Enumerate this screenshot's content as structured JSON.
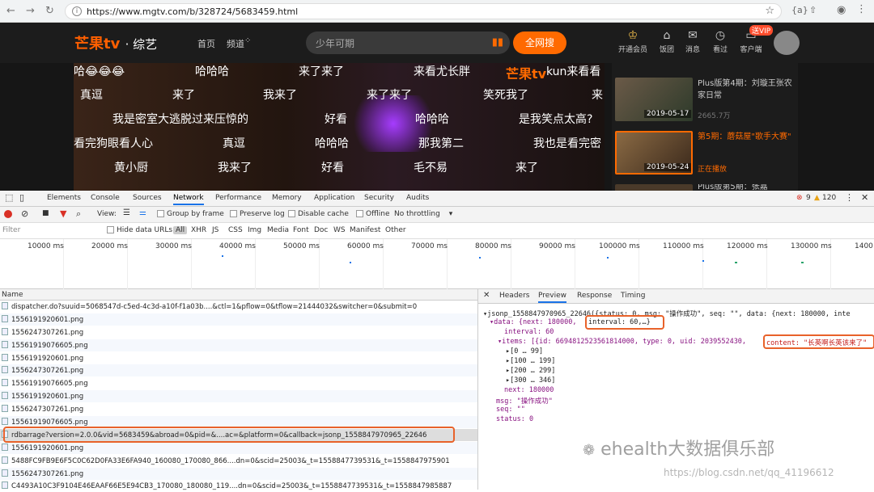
{
  "browser": {
    "url": "https://www.mgtv.com/b/328724/5683459.html",
    "ext1": "{a}",
    "ext2": "⇧"
  },
  "site": {
    "logo": "芒果tv",
    "logo_sub": "· 综艺",
    "nav": [
      "首页",
      "频道"
    ],
    "search_placeholder": "少年可期",
    "search_button": "全网搜",
    "icons": [
      {
        "name": "开通会员",
        "glyph": "♔"
      },
      {
        "name": "饭团",
        "glyph": "⌂"
      },
      {
        "name": "消息",
        "glyph": "✉"
      },
      {
        "name": "看过",
        "glyph": "◷"
      },
      {
        "name": "客户端",
        "glyph": "▭"
      }
    ],
    "vip_badge": "送VIP"
  },
  "danmaku": [
    {
      "text": "哈😂😂😂"
    },
    {
      "text": "哈哈哈"
    },
    {
      "text": "来了来了"
    },
    {
      "text": "来看尤长胖"
    },
    {
      "text": "kun来看看"
    },
    {
      "text": "真逗"
    },
    {
      "text": "来了"
    },
    {
      "text": "我来了"
    },
    {
      "text": "来了来了"
    },
    {
      "text": "笑死我了"
    },
    {
      "text": "来"
    },
    {
      "text": "我是密室大逃脱过来压惊的"
    },
    {
      "text": "好看"
    },
    {
      "text": "哈哈哈"
    },
    {
      "text": "是我笑点太高?"
    },
    {
      "text": "看完狗眼看人心"
    },
    {
      "text": "真逗"
    },
    {
      "text": "哈哈哈"
    },
    {
      "text": "那我第二"
    },
    {
      "text": "我也是看完密"
    },
    {
      "text": "黄小厨"
    },
    {
      "text": "我来了"
    },
    {
      "text": "好看"
    },
    {
      "text": "毛不易"
    },
    {
      "text": "来了"
    }
  ],
  "video_watermark": "芒果tv",
  "playlist": [
    {
      "title": "Plus版第4期：刘璇王张农家日常",
      "date": "2019-05-17",
      "meta": "2665.7万"
    },
    {
      "title": "第5期：蘑菇屋\"歌手大赛\"",
      "date": "2019-05-24",
      "meta": "正在播放"
    },
    {
      "title": "Plus版第5期：张嘉"
    }
  ],
  "devtools": {
    "tabs": [
      "Elements",
      "Console",
      "Sources",
      "Network",
      "Performance",
      "Memory",
      "Application",
      "Security",
      "Audits"
    ],
    "active_tab": "Network",
    "errors": "9",
    "warnings": "120",
    "toolbar": {
      "view": "View:",
      "group": "Group by frame",
      "preserve": "Preserve log",
      "cache": "Disable cache",
      "offline": "Offline",
      "throttle": "No throttling"
    },
    "filter": {
      "placeholder": "Filter",
      "hide": "Hide data URLs",
      "types": [
        "All",
        "XHR",
        "JS",
        "CSS",
        "Img",
        "Media",
        "Font",
        "Doc",
        "WS",
        "Manifest",
        "Other"
      ]
    },
    "ticks": [
      "10000 ms",
      "20000 ms",
      "30000 ms",
      "40000 ms",
      "50000 ms",
      "60000 ms",
      "70000 ms",
      "80000 ms",
      "90000 ms",
      "100000 ms",
      "110000 ms",
      "120000 ms",
      "130000 ms",
      "1400"
    ],
    "list_header": "Name",
    "requests": [
      "dispatcher.do?suuid=5068547d-c5ed-4c3d-a10f-f1a03b....&ctl=1&pflow=0&tflow=21444032&switcher=0&submit=0",
      "1556191920601.png",
      "1556247307261.png",
      "1556191907660​5.png",
      "1556191920601.png",
      "1556247307261.png",
      "1556191907660​5.png",
      "1556191920601.png",
      "1556247307261.png",
      "1556191907660​5.png",
      "rdbarrage?version=2.0.0&vid=5683459&abroad=0&pid=&....ac=&platform=0&callback=jsonp_1558847970965_22646",
      "1556191920601.png",
      "5488FC9FB9E6F5C0C62D0FA33E6FA940_160080_170080_866....dn=0&scid=25003&_t=1558847739531&_t=1558847975901",
      "1556247307261.png",
      "C4493A10C3F9104E46EAAF66E5E94CB3_170080_180080_119....dn=0&scid=25003&_t=1558847739531&_t=1558847985887"
    ],
    "preview_tabs": [
      "Headers",
      "Preview",
      "Response",
      "Timing"
    ],
    "preview_active": "Preview",
    "preview_lines": {
      "l1": "▾jsonp_1558847970965_22646({status: 0, msg: \"操作成功\", seq: \"\", data: {next: 180000, inte",
      "l2_a": "▾data: {next: 180000,",
      "l2_b": "interval: 60,…}",
      "l3": "interval: 60",
      "l4_a": "▾items: [{id: 6694812523561814000, type: 0, uid: 2039552430,",
      "l4_b": "content: \"长英啊长英该来了\"",
      "l5": "▸[0 … 99]",
      "l6": "▸[100 … 199]",
      "l7": "▸[200 … 299]",
      "l8": "▸[300 … 346]",
      "l9": "next: 180000",
      "l10": "msg: \"操作成功\"",
      "l11": "seq: \"\"",
      "l12": "status: 0"
    }
  },
  "watermark": "ehealth大数据俱乐部",
  "watermark_url": "https://blog.csdn.net/qq_41196612"
}
